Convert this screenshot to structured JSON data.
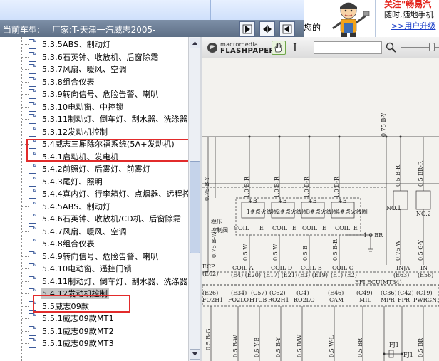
{
  "header": {
    "car_label": "当前车型:",
    "car_value": "厂家:T-天津一汽威志2005-",
    "cut_text": "您的",
    "ad_line1": "关注\"畅易汽",
    "ad_line2": "随时,随地手机",
    "ad_link": ">>用户升级"
  },
  "tree": {
    "items": [
      {
        "label": "5.3.5ABS、制动灯"
      },
      {
        "label": "5.3.6石英钟、收放机、后窗除霜"
      },
      {
        "label": "5.3.7风扇、暖风、空调"
      },
      {
        "label": "5.3.8组合仪表"
      },
      {
        "label": "5.3.9转向信号、危险告警、喇叭"
      },
      {
        "label": "5.3.10电动窗、中控锁"
      },
      {
        "label": "5.3.11制动灯、倒车灯、刮水器、洗涤器"
      },
      {
        "label": "5.3.12发动机控制"
      },
      {
        "label": "5.4威志三厢除尔福系统(5A+发动机)"
      },
      {
        "label": "5.4.1启动机、发电机"
      },
      {
        "label": "5.4.2前照灯、后雾灯、前雾灯"
      },
      {
        "label": "5.4.3尾灯、照明"
      },
      {
        "label": "5.4.4真内灯、行李箱灯、点烟器、远程控"
      },
      {
        "label": "5.4.5ABS、制动灯"
      },
      {
        "label": "5.4.6石英钟、收放机/CD机、后窗除霜"
      },
      {
        "label": "5.4.7风扇、暖风、空调"
      },
      {
        "label": "5.4.8组合仪表"
      },
      {
        "label": "5.4.9转向信号、危险告警、喇叭"
      },
      {
        "label": "5.4.10电动窗、遥控门锁"
      },
      {
        "label": "5.4.11制动灯、倒车灯、刮水器、洗涤器"
      },
      {
        "label": "5.4.12发动机控制"
      },
      {
        "label": "5.5威志09款"
      },
      {
        "label": "5.5.1威志09款MT1"
      },
      {
        "label": "5.5.1威志09款MT2"
      },
      {
        "label": "5.5.1威志09款MT3"
      }
    ],
    "selected_index": 20
  },
  "flashpaper": {
    "logo_top": "macromedia",
    "logo_bottom": "FLASHPAPER",
    "ibeam": "I"
  },
  "diagram": {
    "labels": {
      "coil1": "1#点火线圈",
      "coil2": "2#点火线圈",
      "coil3": "3#点火线圈",
      "coil4": "4#点火线圈",
      "plusb": "+B",
      "coil": "COIL",
      "e": "E",
      "bw": "0.75 B-Y",
      "br10": "1.0 B-R",
      "br10b": "1.0 BR",
      "brm": "0.5 B-R",
      "stab": "稳压",
      "ctrl": "控制阀",
      "no1": "NO.1",
      "no2": "NO.2",
      "w075": "0.75 W",
      "ecp": "ECP",
      "e62": "(E62)",
      "coila": "COIL A",
      "e4e20": "(E4) (E20)",
      "coild": "COIL D",
      "e17e21": "(E17) (E21)",
      "coilb": "COIL B",
      "e3e19": "(E3) (E19)",
      "coilc": "COIL C",
      "e1e2": "(E1) (E2)",
      "inja": "INJA",
      "e63": "(E63)",
      "inj2": "IN",
      "e56": "(E56)",
      "ecu": "EFI ECU(MT34)",
      "e26": "(E26)",
      "e34": "(E34)",
      "c57": "(C57)",
      "c62": "(C62)",
      "c4": "(C4)",
      "e46": "(E46)",
      "c49": "(C49)",
      "c36": "(C36)",
      "c42": "(C42)",
      "c19": "(C19)",
      "fo2h1": "FO2H1",
      "fo2lo": "FO2LO",
      "htcb": "HTCB",
      "ro2h1": "RO2H1",
      "ro2lo": "RO2LO",
      "cam": "CAM",
      "mil": "MIL",
      "mpr": "MPR",
      "fpr": "FPR",
      "pwrgnd": "PWRGND",
      "w05": "0.5 W-L",
      "fj1": "FJ1",
      "fj1b": "FJ1",
      "r05g": "0.5 B-G",
      "r05w": "0.5 B-W",
      "rb": "0.5 B",
      "rw": "0.5 W",
      "rbw": "0.5 B/W",
      "rbr": "0.5 B-R",
      "ryb": "0.5 Y-B",
      "rby": "0.5 B-Y",
      "rbrb": "0.5 BR",
      "r075bw": "0.75 B-W",
      "r075by": "0.75 B-Y",
      "rgy": "0.5 G-Y",
      "rbrr": "0.5 BR-R",
      "r3": "0.5 BR"
    }
  }
}
